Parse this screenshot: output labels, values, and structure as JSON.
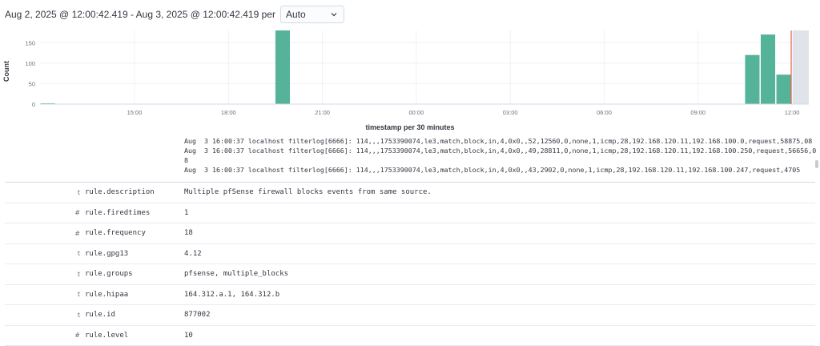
{
  "toolbar": {
    "time_range": "Aug 2, 2025 @ 12:00:42.419 - Aug 3, 2025 @ 12:00:42.419 per",
    "interval_value": "Auto",
    "dropdown_icon": "chevron-down-icon"
  },
  "chart_data": {
    "type": "bar",
    "ylabel": "Count",
    "xlabel": "timestamp per 30 minutes",
    "ylim": [
      0,
      180
    ],
    "y_ticks": [
      0,
      50,
      100,
      150
    ],
    "x_ticks": [
      "15:00",
      "18:00",
      "21:00",
      "00:00",
      "03:00",
      "06:00",
      "09:00",
      "12:00"
    ],
    "grid": true,
    "bars": [
      {
        "time": "19:30",
        "value": 180
      },
      {
        "time": "10:30",
        "value": 120
      },
      {
        "time": "11:00",
        "value": 170
      },
      {
        "time": "11:30",
        "value": 72
      },
      {
        "time": "12:00",
        "value": 2
      }
    ],
    "bar_color": "#54b399",
    "partial_bucket_color": "#e0e4ea",
    "now_marker_color": "#e7664c"
  },
  "log": {
    "lines": [
      "Aug  3 16:00:37 localhost filterlog[6666]: 114,,,1753390074,le3,match,block,in,4,0x0,,52,12560,0,none,1,icmp,28,192.168.120.11,192.168.100.0,request,58875,08",
      "Aug  3 16:00:37 localhost filterlog[6666]: 114,,,1753390074,le3,match,block,in,4,0x0,,49,28811,0,none,1,icmp,28,192.168.120.11,192.168.100.250,request,56656,08",
      "Aug  3 16:00:37 localhost filterlog[6666]: 114,,,1753390074,le3,match,block,in,4,0x0,,43,2902,0,none,1,icmp,28,192.168.120.11,192.168.100.247,request,4705"
    ]
  },
  "fields": [
    {
      "type": "t",
      "name": "rule.description",
      "value": "Multiple pfSense firewall blocks events from same source."
    },
    {
      "type": "#",
      "name": "rule.firedtimes",
      "value": "1"
    },
    {
      "type": "#",
      "name": "rule.frequency",
      "value": "18"
    },
    {
      "type": "t",
      "name": "rule.gpg13",
      "value": "4.12"
    },
    {
      "type": "t",
      "name": "rule.groups",
      "value": "pfsense, multiple_blocks"
    },
    {
      "type": "t",
      "name": "rule.hipaa",
      "value": "164.312.a.1, 164.312.b"
    },
    {
      "type": "t",
      "name": "rule.id",
      "value": "877002"
    },
    {
      "type": "#",
      "name": "rule.level",
      "value": "10"
    }
  ]
}
